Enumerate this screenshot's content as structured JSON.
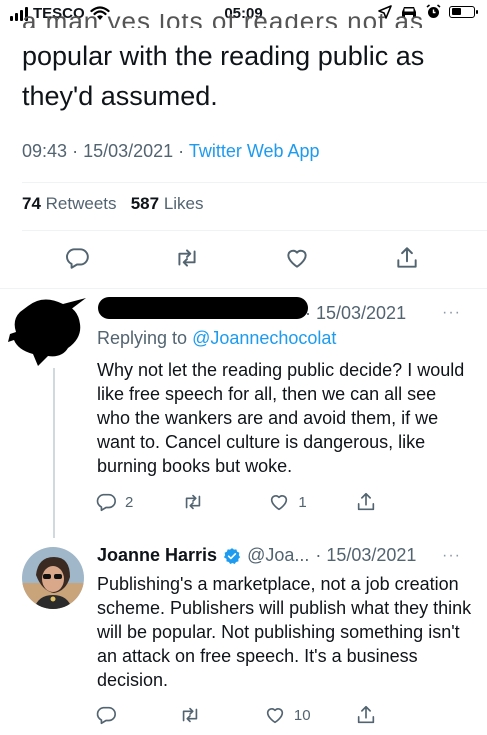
{
  "status_bar": {
    "carrier": "TESCO",
    "time": "05:09"
  },
  "tweet": {
    "cut_text": "a man yes lots of readers not as",
    "text": "popular with the reading public as they'd assumed.",
    "time": "09:43",
    "date": "15/03/2021",
    "source": "Twitter Web App",
    "retweets_count": "74",
    "retweets_label": "Retweets",
    "likes_count": "587",
    "likes_label": "Likes"
  },
  "reply1": {
    "date_suffix": "· 15/03/2021",
    "more": "···",
    "replying_prefix": "Replying to ",
    "replying_handle": "@Joannechocolat",
    "text": "Why not let the reading public decide? I would like free speech for all, then we can all see who the wankers are and avoid them, if we want to. Cancel culture is dangerous, like burning books but woke.",
    "reply_count": "2",
    "retweet_count": "",
    "like_count": "1"
  },
  "reply2": {
    "name": "Joanne Harris",
    "handle": "@Joa...",
    "date": "· 15/03/2021",
    "more": "···",
    "text": "Publishing's a marketplace, not a job creation scheme. Publishers will publish what they think will be popular. Not publishing something isn't an attack on free speech. It's a business decision.",
    "reply_count": "",
    "retweet_count": "",
    "like_count": "10"
  },
  "colors": {
    "accent": "#1d9bf0",
    "secondary_text": "#536471",
    "text": "#0f1419"
  }
}
